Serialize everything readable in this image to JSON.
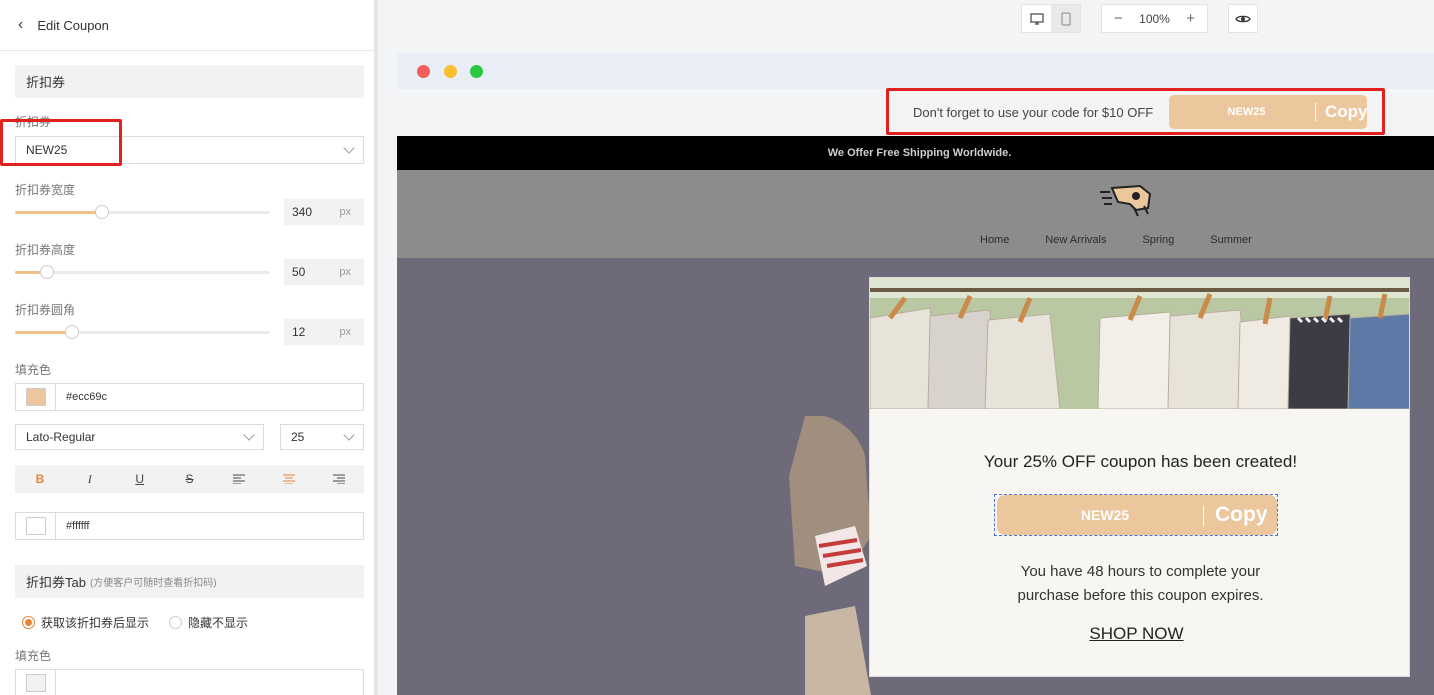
{
  "panel": {
    "title": "Edit Coupon",
    "section_coupon": "折扣券",
    "coupon_label": "折扣券",
    "coupon_value": "NEW25",
    "width_label": "折扣券宽度",
    "width_value": "340",
    "height_label": "折扣券高度",
    "height_value": "50",
    "radius_label": "折扣券圆角",
    "radius_value": "12",
    "unit": "px",
    "fill_label": "填充色",
    "fill_color": "#ecc69c",
    "font_family": "Lato-Regular",
    "font_size": "25",
    "format_buttons": [
      "B",
      "I",
      "U",
      "S"
    ],
    "text_color": "#ffffff",
    "section_tab": "折扣券Tab",
    "section_tab_hint": "(方便客户可随时查看折扣码)",
    "radio_show": "获取该折扣券后显示",
    "radio_hide": "隐藏不显示",
    "fill_label_2": "填充色",
    "slider_levels": {
      "width": 0.34,
      "height": 0.125,
      "radius": 0.22
    }
  },
  "topbar": {
    "zoom": "100%",
    "zoom_minus": "−",
    "zoom_plus": "+"
  },
  "preview": {
    "reminder_text": "Don't forget to use your code for $10 OFF",
    "reminder_code": "NEW25",
    "reminder_copy": "Copy",
    "announcement": "We Offer Free Shipping Worldwide.",
    "nav_links": [
      "Home",
      "New Arrivals",
      "Spring",
      "Summer"
    ],
    "popup_title": "Your 25% OFF coupon has been created!",
    "popup_code": "NEW25",
    "popup_copy": "Copy",
    "popup_desc_1": "You have 48 hours to complete your",
    "popup_desc_2": "purchase before this coupon expires.",
    "popup_cta": "SHOP NOW"
  },
  "colors": {
    "accent": "#e8833a",
    "coupon": "#ecc69c",
    "highlight": "#e32020",
    "selection": "#4a73d6"
  }
}
